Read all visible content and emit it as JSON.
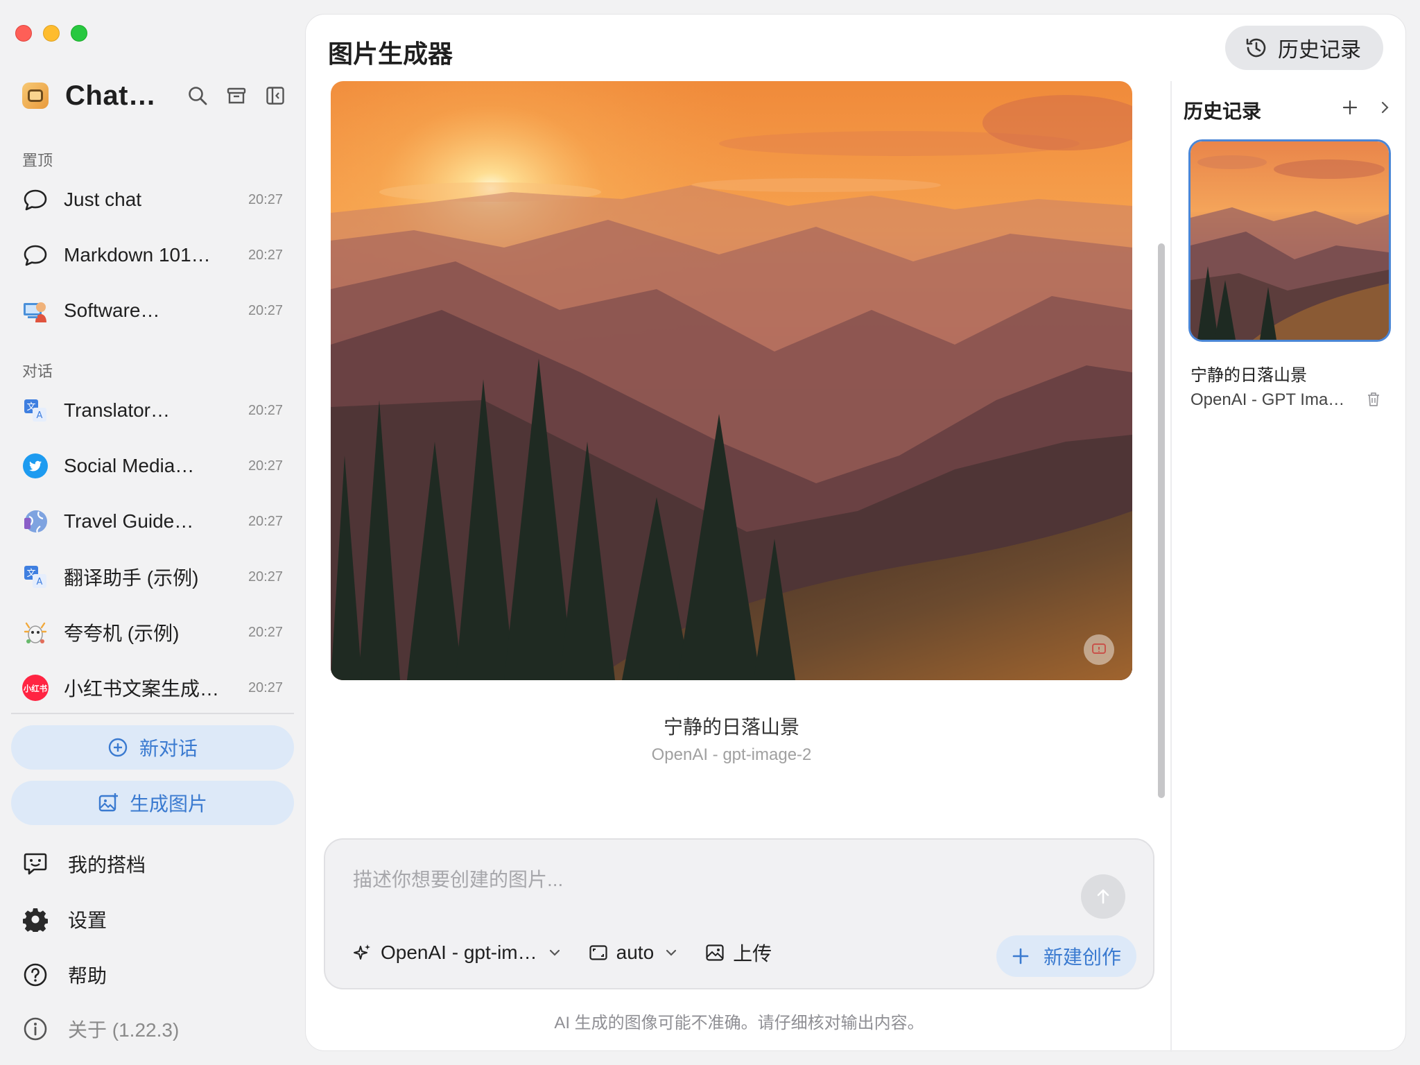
{
  "window": {
    "traffic_lights": [
      "close",
      "minimize",
      "maximize"
    ]
  },
  "sidebar": {
    "brand_title": "Chat…",
    "pinned_label": "置顶",
    "conversations_label": "对话",
    "pinned": [
      {
        "name": "Just chat",
        "time": "20:27",
        "icon": "chat-bubble-icon"
      },
      {
        "name": "Markdown 101…",
        "time": "20:27",
        "icon": "chat-bubble-icon"
      },
      {
        "name": "Software…",
        "time": "20:27",
        "icon": "software-avatar-icon"
      }
    ],
    "conversations": [
      {
        "name": "Translator…",
        "time": "20:27",
        "icon": "translate-icon"
      },
      {
        "name": "Social Media…",
        "time": "20:27",
        "icon": "twitter-bird-icon"
      },
      {
        "name": "Travel Guide…",
        "time": "20:27",
        "icon": "globe-icon"
      },
      {
        "name": "翻译助手 (示例)",
        "time": "20:27",
        "icon": "translate-icon"
      },
      {
        "name": "夸夸机 (示例)",
        "time": "20:27",
        "icon": "party-icon"
      },
      {
        "name": "小红书文案生成…",
        "time": "20:27",
        "icon": "xiaohongshu-icon",
        "badge_text": "小红书"
      }
    ],
    "new_chat_label": "新对话",
    "generate_image_label": "生成图片",
    "menu": {
      "partners": "我的搭档",
      "settings": "设置",
      "help": "帮助",
      "about": "关于 (1.22.3)"
    }
  },
  "main": {
    "title": "图片生成器",
    "history_button": "历史记录",
    "image": {
      "title": "宁静的日落山景",
      "model": "OpenAI - gpt-image-2"
    },
    "prompt": {
      "placeholder": "描述你想要创建的图片...",
      "model_select": "OpenAI - gpt-im…",
      "size_select": "auto",
      "upload_label": "上传",
      "new_create_label": "新建创作"
    },
    "disclaimer": "AI 生成的图像可能不准确。请仔细核对输出内容。"
  },
  "history": {
    "title": "历史记录",
    "items": [
      {
        "name": "宁静的日落山景",
        "model": "OpenAI - GPT Ima…"
      }
    ]
  },
  "colors": {
    "accent": "#3a7ad0",
    "accent_bg": "#dde9f8",
    "selected_border": "#4a86d6"
  }
}
